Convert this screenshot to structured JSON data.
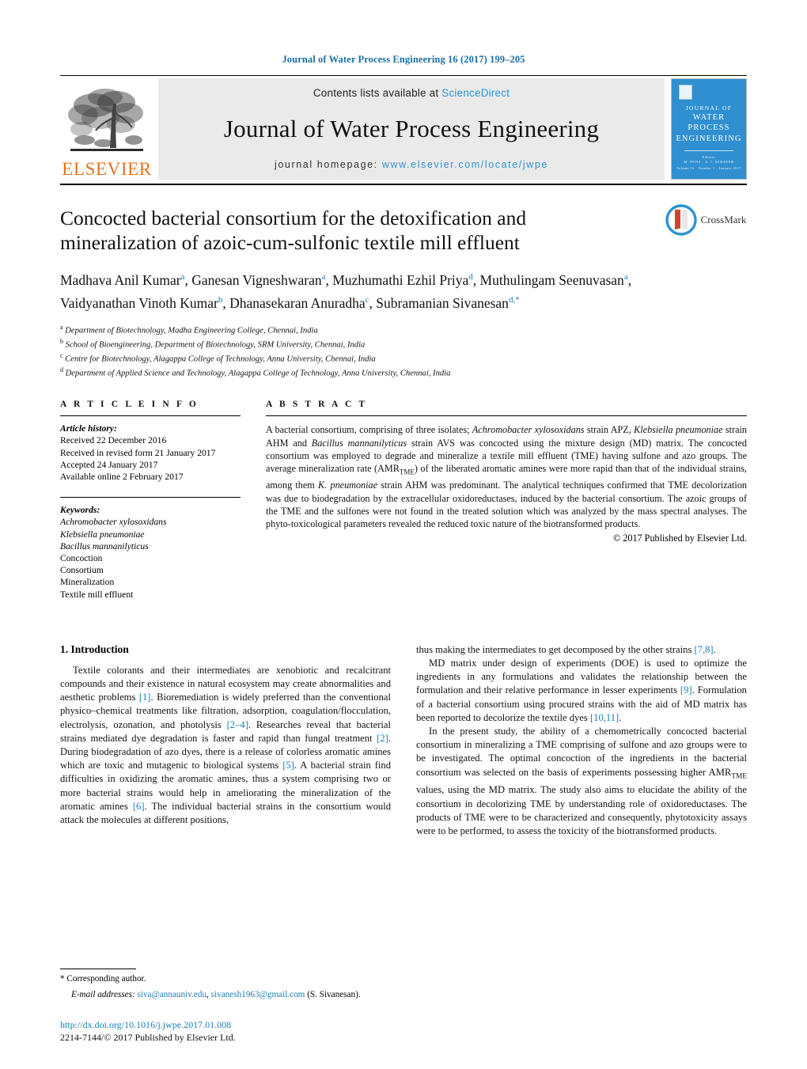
{
  "running_head": "Journal of Water Process Engineering 16 (2017) 199–205",
  "masthead": {
    "contents_prefix": "Contents lists available at ",
    "sciencedirect": "ScienceDirect",
    "journal_title": "Journal of Water Process Engineering",
    "homepage_prefix": "journal homepage: ",
    "homepage_url": "www.elsevier.com/locate/jwpe",
    "publisher": "ELSEVIER",
    "cover": {
      "line1": "JOURNAL OF",
      "line2": "WATER PROCESS",
      "line3": "ENGINEERING",
      "sub1": "Editors",
      "sub2": "M. PONS · A. I. SCHÄFER",
      "bottom": "Volume 16 · Number 1 · January 2017"
    },
    "accent_blue": "#2d93d0",
    "elsevier_orange": "#E8721C"
  },
  "article": {
    "title": "Concocted bacterial consortium for the detoxification and mineralization of azoic-cum-sulfonic textile mill effluent",
    "crossmark_label": "CrossMark",
    "authors": [
      {
        "name": "Madhava Anil Kumar",
        "sup": "a",
        "sep": ", "
      },
      {
        "name": "Ganesan Vigneshwaran",
        "sup": "a",
        "sep": ", "
      },
      {
        "name": "Muzhumathi Ezhil Priya",
        "sup": "d",
        "sep": ", "
      },
      {
        "name": "Muthulingam Seenuvasan",
        "sup": "a",
        "sep": ", "
      },
      {
        "name": "Vaidyanathan Vinoth Kumar",
        "sup": "b",
        "sep": ", "
      },
      {
        "name": "Dhanasekaran Anuradha",
        "sup": "c",
        "sep": ", "
      },
      {
        "name": "Subramanian Sivanesan",
        "sup": "d,*",
        "sep": ""
      }
    ],
    "affiliations": [
      {
        "mark": "a",
        "text": "Department of Biotechnology, Madha Engineering College, Chennai, India"
      },
      {
        "mark": "b",
        "text": "School of Bioengineering, Department of Biotechnology, SRM University, Chennai, India"
      },
      {
        "mark": "c",
        "text": "Centre for Biotechnology, Alagappa College of Technology, Anna University, Chennai, India"
      },
      {
        "mark": "d",
        "text": "Department of Applied Science and Technology, Alagappa College of Technology, Anna University, Chennai, India"
      }
    ]
  },
  "article_info": {
    "heading": "A R T I C L E   I N F O",
    "history_label": "Article history:",
    "history": [
      "Received 22 December 2016",
      "Received in revised form 21 January 2017",
      "Accepted 24 January 2017",
      "Available online 2 February 2017"
    ],
    "keywords_label": "Keywords:",
    "keywords": [
      {
        "text": "Achromobacter xylosoxidans",
        "italic": true
      },
      {
        "text": "Klebsiella pneumoniae",
        "italic": true
      },
      {
        "text": "Bacillus mannanilyticus",
        "italic": true
      },
      {
        "text": "Concoction",
        "italic": false
      },
      {
        "text": "Consortium",
        "italic": false
      },
      {
        "text": "Mineralization",
        "italic": false
      },
      {
        "text": "Textile mill effluent",
        "italic": false
      }
    ]
  },
  "abstract": {
    "heading": "A B S T R A C T",
    "copyright": "© 2017 Published by Elsevier Ltd."
  },
  "sections": {
    "introduction_title": "1.  Introduction"
  },
  "footnote": {
    "corresponding": "* Corresponding author.",
    "email_label": "E-mail addresses:",
    "email1": "siva@annauniv.edu",
    "email2": "sivanesh1963@gmail.com",
    "email_suffix": "(S. Sivanesan).",
    "doi": "http://dx.doi.org/10.1016/j.jwpe.2017.01.008",
    "issn_line": "2214-7144/© 2017 Published by Elsevier Ltd."
  }
}
